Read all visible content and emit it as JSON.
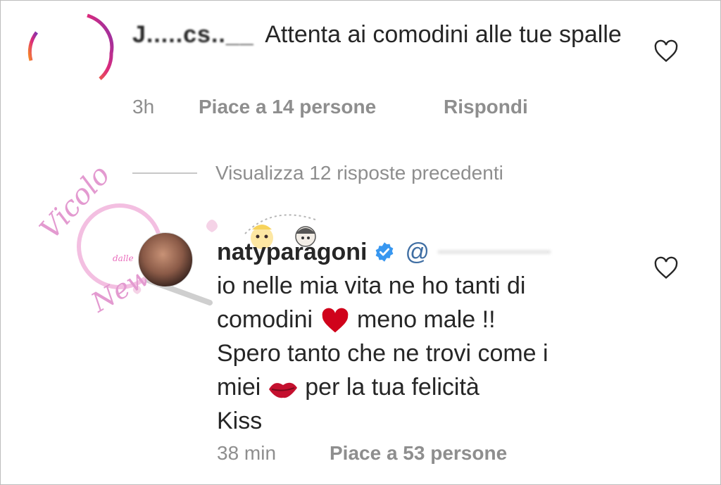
{
  "comments": [
    {
      "username_obscured": "J.....cs..__",
      "text": "Attenta ai comodini alle tue spalle",
      "time": "3h",
      "likes": "Piace a 14 persone",
      "reply": "Rispondi"
    },
    {
      "username": "natyparagoni",
      "mention": "@",
      "lines": [
        "io nelle mia vita ne ho tanti di",
        "comodini",
        "meno male !!",
        "Spero tanto che ne trovi come i",
        "miei",
        "per la tua felicità",
        "Kiss"
      ],
      "time": "38 min",
      "likes": "Piace a 53 persone"
    }
  ],
  "view_replies": "Visualizza 12 risposte precedenti",
  "watermark": {
    "line1": "Vicolo",
    "line2": "dalle",
    "line3": "News"
  },
  "icons": {
    "like": "heart-outline-icon",
    "verified": "verified-badge-icon",
    "emoji1": "red-heart-emoji",
    "emoji2": "kiss-lips-emoji"
  },
  "colors": {
    "text": "#262626",
    "meta": "#8e8e8e",
    "verified": "#3897f0",
    "heart": "#d0021b"
  }
}
